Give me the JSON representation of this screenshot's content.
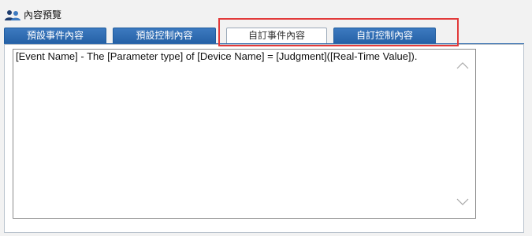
{
  "header": {
    "title": "內容預覽",
    "icon": "users-icon"
  },
  "tabs": [
    {
      "label": "預設事件內容",
      "active": false
    },
    {
      "label": "預設控制內容",
      "active": false
    },
    {
      "label": "自訂事件內容",
      "active": true
    },
    {
      "label": "自訂控制內容",
      "active": false
    }
  ],
  "content": {
    "text": "[Event Name] - The [Parameter type] of [Device Name] = [Judgment]([Real-Time Value])."
  },
  "colors": {
    "tab_active_bg": "#ffffff",
    "tab_inactive_bg": "#2561a6",
    "highlight": "#e23a3a"
  }
}
